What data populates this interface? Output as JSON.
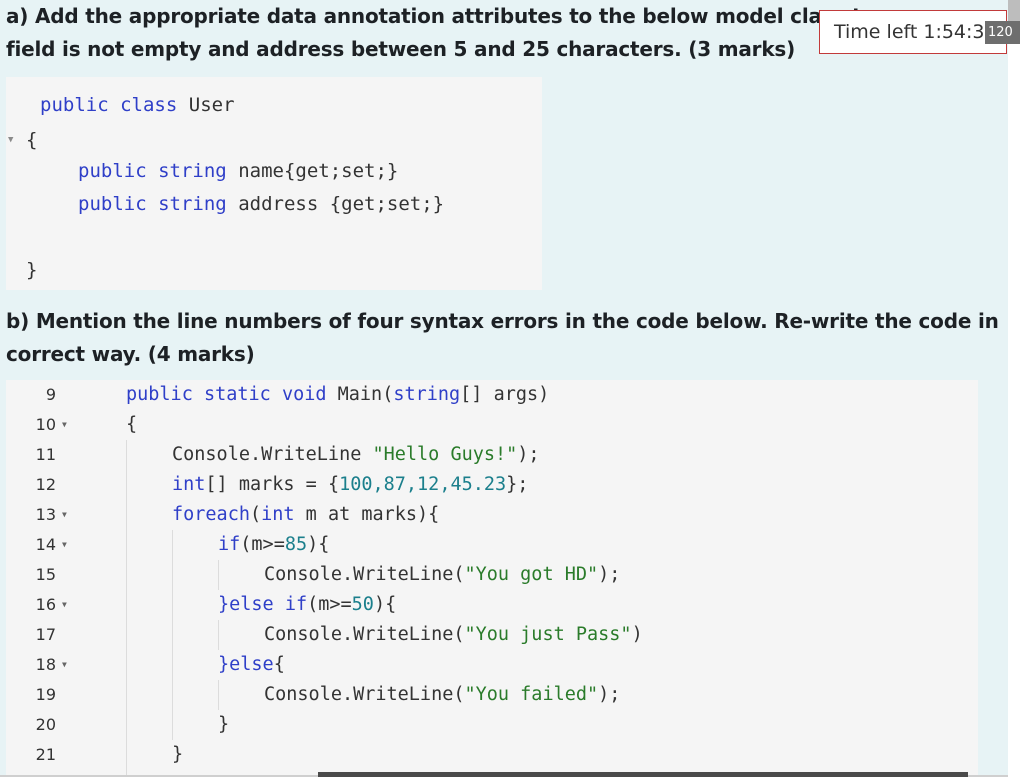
{
  "question_a": {
    "line1": "a) Add the appropriate data annotation attributes to the below model class t",
    "line2": "field is not empty and address between 5 and 25 characters. (3 marks)"
  },
  "code_a": {
    "lines": [
      {
        "k1": "public",
        "k2": "class",
        "rest": "User"
      },
      {
        "text": "{"
      },
      {
        "k1": "public",
        "k2": "string",
        "rest": "name{get;set;}"
      },
      {
        "k1": "public",
        "k2": "string",
        "rest": "address {get;set;}"
      },
      {
        "text": "}"
      }
    ]
  },
  "question_b": {
    "line1": "b) Mention the line numbers of four syntax errors in the code below. Re-write the code in",
    "line2": "correct way. (4 marks)"
  },
  "editor": {
    "line_numbers": [
      "9",
      "10",
      "11",
      "12",
      "13",
      "14",
      "15",
      "16",
      "17",
      "18",
      "19",
      "20",
      "21"
    ],
    "folds": [
      false,
      true,
      false,
      false,
      true,
      true,
      false,
      true,
      false,
      true,
      false,
      false,
      false
    ],
    "lines": {
      "l9": {
        "kw1": "public",
        "kw2": "static",
        "kw3": "void",
        "rest": "Main(",
        "kw4": "string",
        "rest2": "[] args)"
      },
      "l10": "{",
      "l11": {
        "a": "Console.WriteLine ",
        "s": "\"Hello Guys!\"",
        "b": ");"
      },
      "l12": {
        "kw": "int",
        "a": "[] marks = {",
        "n": "100,87,12,45.23",
        "b": "};"
      },
      "l13": {
        "kw": "foreach",
        "a": "(",
        "kw2": "int",
        "b": " m at marks){"
      },
      "l14": {
        "kw": "if",
        "a": "(m>=",
        "n": "85",
        "b": "){"
      },
      "l15": {
        "a": "Console.WriteLine(",
        "s": "\"You got HD\"",
        "b": ");"
      },
      "l16": {
        "kw": "}else if",
        "a": "(m>=",
        "n": "50",
        "b": "){"
      },
      "l17": {
        "a": "Console.WriteLine(",
        "s": "\"You just Pass\"",
        "b": ")"
      },
      "l18": {
        "kw": "}else",
        "b": "{"
      },
      "l19": {
        "a": "Console.WriteLine(",
        "s": "\"You failed\"",
        "b": ");"
      },
      "l20": "}",
      "l21": "}"
    }
  },
  "timer": {
    "text": "Time left 1:54:3"
  },
  "zoom": {
    "text": "120"
  }
}
